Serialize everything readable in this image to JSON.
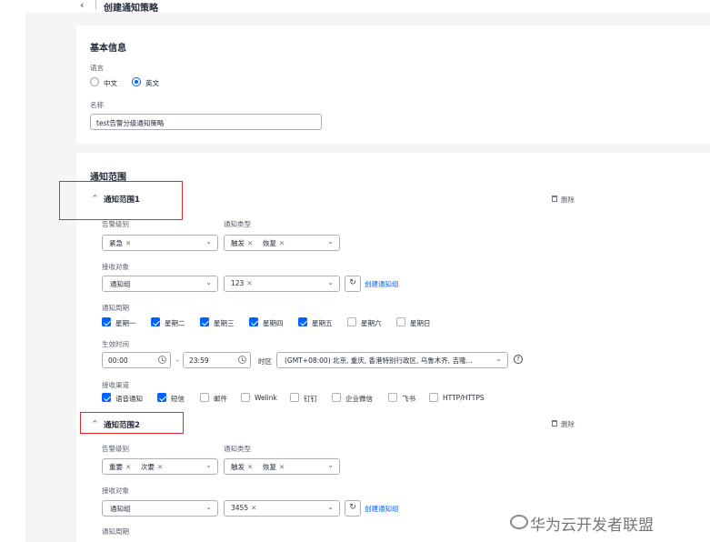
{
  "header": {
    "back": "‹",
    "title": "创建通知策略"
  },
  "basic": {
    "section_title": "基本信息",
    "language_label": "语言",
    "lang_options": [
      "中文",
      "英文"
    ],
    "selected_lang": "英文",
    "name_label": "名称",
    "name_value": "test告警分级通知策略"
  },
  "scope": {
    "section_title": "通知范围",
    "groups": [
      {
        "title": "通知范围1",
        "delete_label": "删除",
        "alarm_level_label": "告警级别",
        "alarm_levels": [
          "紧急"
        ],
        "notify_type_label": "通知类型",
        "notify_types": [
          "触发",
          "恢复"
        ],
        "receiver_label": "接收对象",
        "receiver_type": "通知组",
        "receiver_values": [
          "123"
        ],
        "create_group_link": "创建通知组",
        "period_label": "通知周期",
        "weekdays": [
          {
            "label": "星期一",
            "checked": true
          },
          {
            "label": "星期二",
            "checked": true
          },
          {
            "label": "星期三",
            "checked": true
          },
          {
            "label": "星期四",
            "checked": true
          },
          {
            "label": "星期五",
            "checked": true
          },
          {
            "label": "星期六",
            "checked": false
          },
          {
            "label": "星期日",
            "checked": false
          }
        ],
        "effective_time_label": "生效时间",
        "start_time": "00:00",
        "time_sep": "-",
        "end_time": "23:59",
        "timezone_label": "时区",
        "timezone_value": "(GMT+08:00) 北京, 重庆, 香港特别行政区, 乌鲁木齐, 吉隆...",
        "channel_label": "接收渠道",
        "channels": [
          {
            "label": "语音通知",
            "checked": true
          },
          {
            "label": "短信",
            "checked": true
          },
          {
            "label": "邮件",
            "checked": false
          },
          {
            "label": "Welink",
            "checked": false
          },
          {
            "label": "钉钉",
            "checked": false
          },
          {
            "label": "企业微信",
            "checked": false
          },
          {
            "label": "飞书",
            "checked": false
          },
          {
            "label": "HTTP/HTTPS",
            "checked": false
          }
        ]
      },
      {
        "title": "通知范围2",
        "delete_label": "删除",
        "alarm_level_label": "告警级别",
        "alarm_levels": [
          "重要",
          "次要"
        ],
        "notify_type_label": "通知类型",
        "notify_types": [
          "触发",
          "恢复"
        ],
        "receiver_label": "接收对象",
        "receiver_type": "通知组",
        "receiver_values": [
          "3455"
        ],
        "create_group_link": "创建通知组",
        "period_label": "通知周期"
      }
    ]
  },
  "watermark": "华为云开发者联盟",
  "colors": {
    "primary": "#0062ff",
    "highlight_box": "#e8262d",
    "page_bg": "#f4f5f7"
  }
}
